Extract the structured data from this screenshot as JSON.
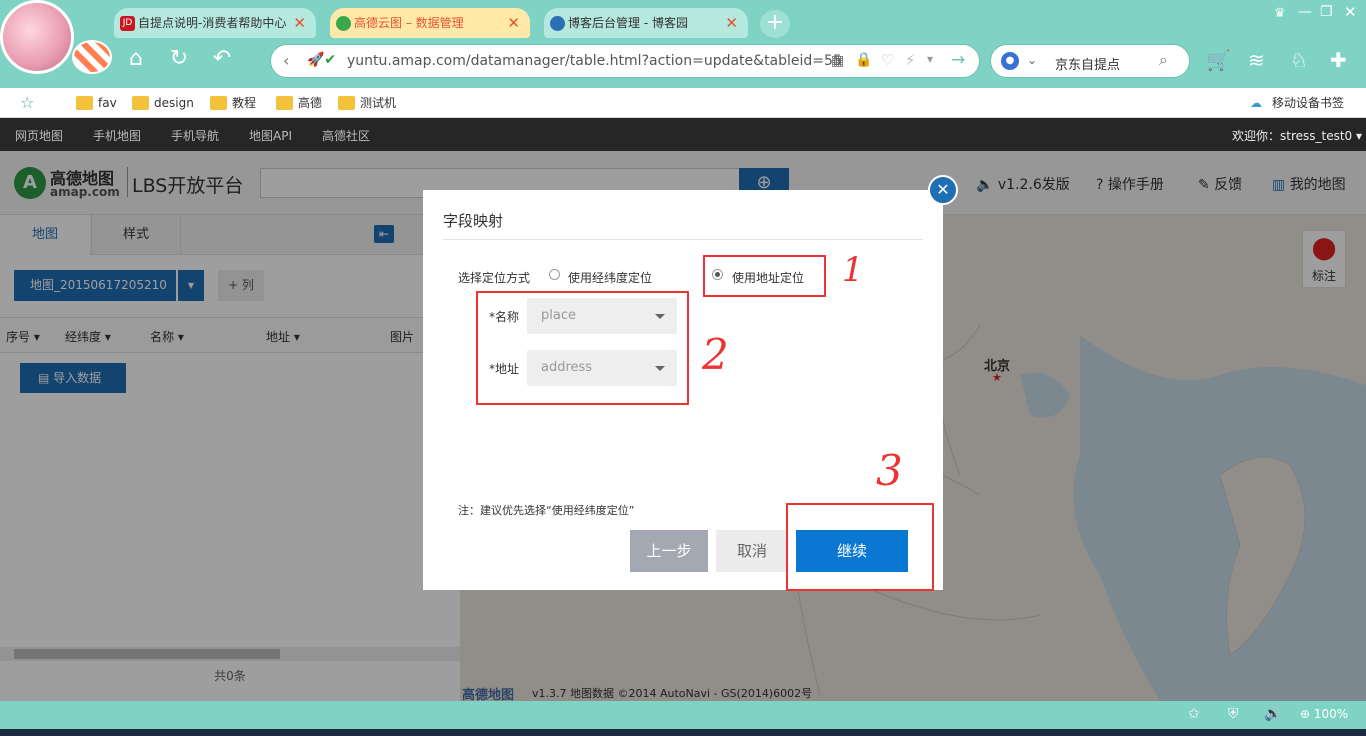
{
  "browser": {
    "tabs": [
      {
        "icon": "JD",
        "title": "自提点说明-消费者帮助中心"
      },
      {
        "icon": "",
        "title": "高德云图 – 数据管理"
      },
      {
        "icon": "",
        "title": "博客后台管理 - 博客园"
      }
    ],
    "url": "yuntu.amap.com/datamanager/table.html?action=update&tableid=55",
    "search_value": "京东自提点",
    "bookmarks": [
      "fav",
      "design",
      "教程",
      "高德",
      "测试机"
    ],
    "mobile_bookmarks": "移动设备书签",
    "zoom": "100%"
  },
  "topnav": {
    "items": [
      "网页地图",
      "手机地图",
      "手机导航",
      "地图API",
      "高德社区"
    ],
    "welcome": "欢迎你：stress_test0"
  },
  "header": {
    "logo_brand": "高德地图",
    "logo_domain": "amap.com",
    "logo_platform": "LBS开放平台",
    "version": "v1.2.6发版",
    "manual": "操作手册",
    "feedback": "反馈",
    "my_map": "我的地图"
  },
  "left_panel": {
    "tab_map": "地图",
    "tab_style": "样式",
    "map_name": "地图_20150617205210",
    "add_column": "+ 列",
    "columns": [
      "序号",
      "经纬度",
      "名称",
      "地址",
      "图片"
    ],
    "import_button": "导入数据",
    "total": "共0条"
  },
  "map": {
    "marker_label": "标注",
    "city_label": "北京",
    "footer_brand": "高德地图",
    "footer_text": "v1.3.7 地图数据 ©2014 AutoNavi - GS(2014)6002号"
  },
  "dialog": {
    "title": "字段映射",
    "locate_label": "选择定位方式",
    "option_latlng": "使用经纬度定位",
    "option_address": "使用地址定位",
    "name_label": "*名称",
    "name_value": "place",
    "address_label": "*地址",
    "address_value": "address",
    "note": "注：建议优先选择“使用经纬度定位”",
    "prev_button": "上一步",
    "cancel_button": "取消",
    "continue_button": "继续",
    "close": "✕"
  },
  "annotations": [
    "1",
    "2",
    "3"
  ],
  "colors": {
    "accent": "#1f6fb5",
    "primary_button": "#0a78d2",
    "annotation_red": "#e33333",
    "browser_teal": "#7fd3c4"
  }
}
